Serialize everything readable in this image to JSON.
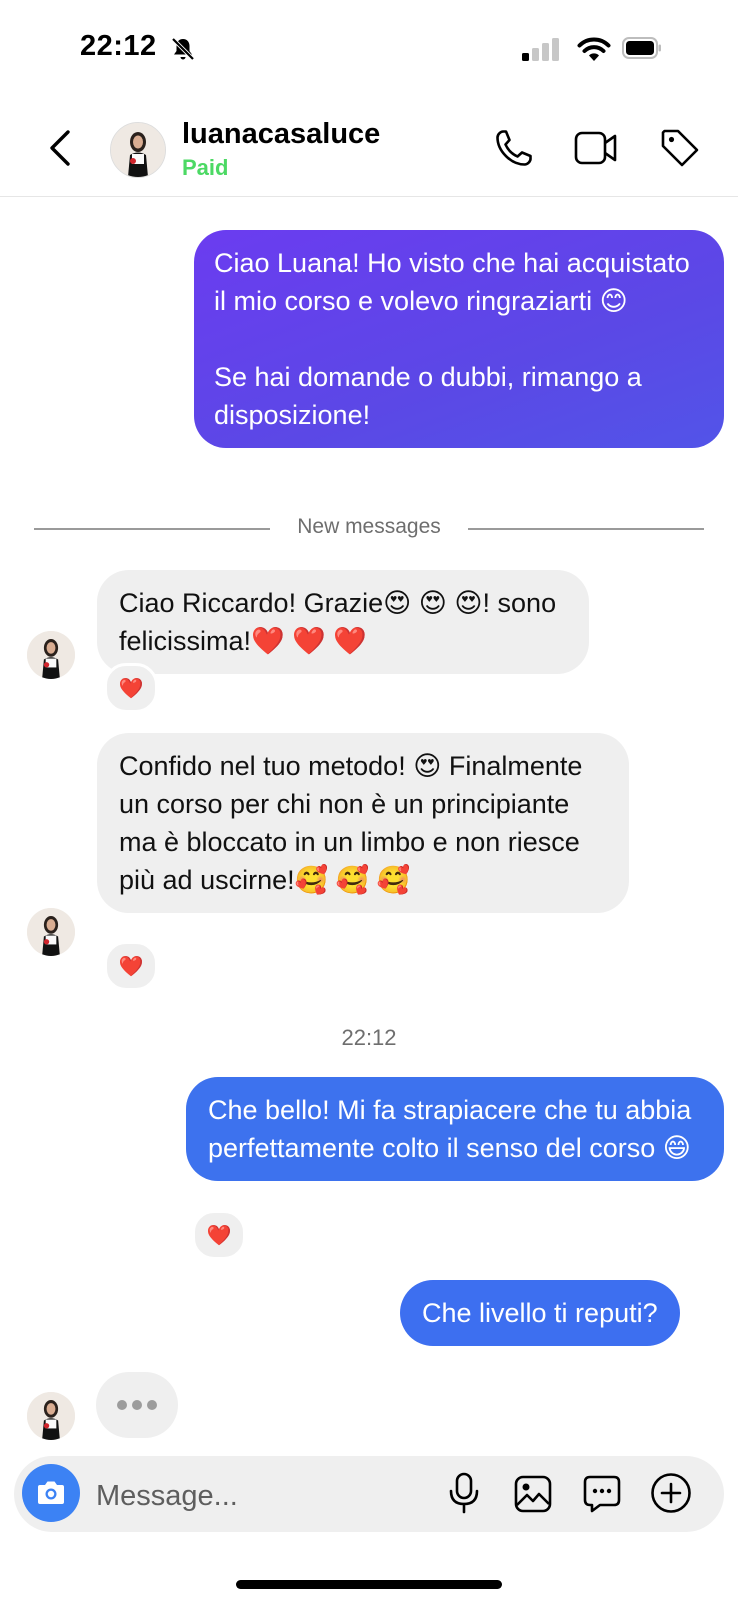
{
  "status_bar": {
    "time": "22:12"
  },
  "header": {
    "username": "luanacasaluce",
    "status": "Paid",
    "status_color": "#4cd964"
  },
  "messages": [
    {
      "id": "m1",
      "direction": "outgoing",
      "text": "Ciao Luana! Ho visto che hai acquistato il mio corso e volevo ringraziarti 😊\n\nSe hai domande o dubbi, rimango a disposizione!",
      "color": "#5b48e6"
    },
    {
      "id": "m2",
      "direction": "incoming",
      "text": "Ciao Riccardo! Grazie😍 😍 😍! sono felicissima!❤️ ❤️ ❤️",
      "reaction": "❤️"
    },
    {
      "id": "m3",
      "direction": "incoming",
      "text": "Confido nel tuo metodo! 😍 Finalmente un corso per chi non è un principiante ma è bloccato in un limbo e non riesce più ad uscirne!🥰 🥰 🥰",
      "reaction": "❤️"
    },
    {
      "id": "m4",
      "direction": "outgoing",
      "text": "Che bello! Mi fa strapiacere che tu abbia perfettamente colto il senso del corso 😄",
      "reaction": "❤️",
      "color": "#3d72ee"
    },
    {
      "id": "m5",
      "direction": "outgoing",
      "text": "Che livello ti reputi?",
      "color": "#3d6ff0"
    }
  ],
  "separators": {
    "new_messages": "New messages",
    "timestamp": "22:12"
  },
  "composer": {
    "placeholder": "Message..."
  },
  "icons": {
    "back": "chevron-left-icon",
    "call": "phone-icon",
    "video": "video-camera-icon",
    "label": "tag-icon",
    "camera": "camera-icon",
    "mic": "microphone-icon",
    "gallery": "image-icon",
    "sticker": "sticker-icon",
    "more": "plus-circle-icon"
  }
}
